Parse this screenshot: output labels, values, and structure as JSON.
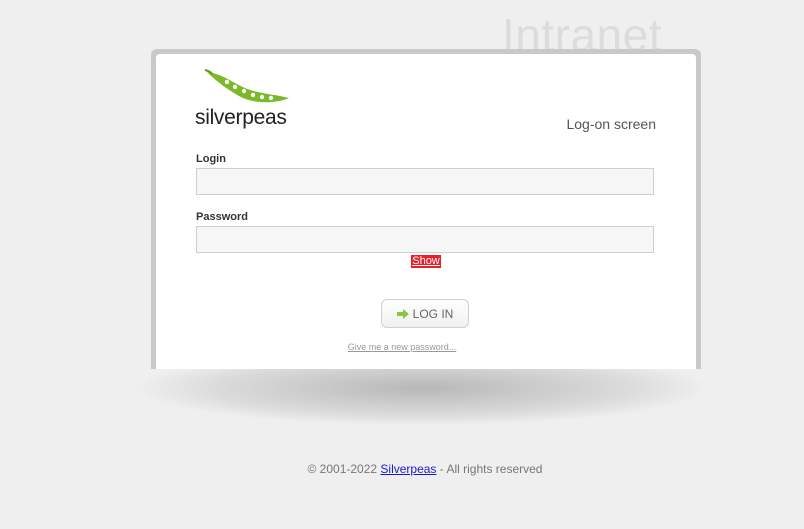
{
  "header": {
    "intranet_text": "Intranet"
  },
  "logo": {
    "wordmark": "silverpeas",
    "leaf_color": "#7ab929"
  },
  "screen": {
    "title": "Log-on screen"
  },
  "form": {
    "login_label": "Login",
    "login_value": "",
    "password_label": "Password",
    "password_value": "",
    "show_label": "Show",
    "login_button": "LOG IN",
    "forgot_link": "Give me a new password..."
  },
  "footer": {
    "copyright": "© 2001-2022 ",
    "link": "Silverpeas",
    "suffix": " - All rights reserved"
  },
  "colors": {
    "accent_red": "#e8202a",
    "link_blue": "#1a1ad6",
    "arrow_green": "#8cc63f"
  }
}
